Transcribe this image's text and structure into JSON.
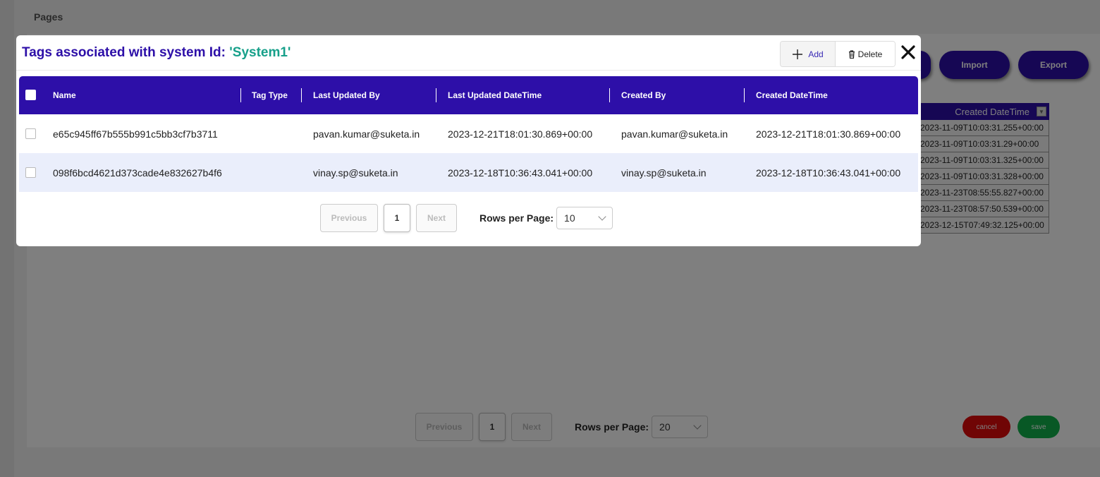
{
  "background": {
    "pages_title": "Pages",
    "buttons": {
      "import": "Import",
      "export": "Export"
    },
    "grid": {
      "header": "Created DateTime",
      "rows": [
        "2023-11-09T10:03:31.255+00:00",
        "2023-11-09T10:03:31.29+00:00",
        "2023-11-09T10:03:31.325+00:00",
        "2023-11-09T10:03:31.328+00:00",
        "2023-11-23T08:55:55.827+00:00",
        "2023-11-23T08:57:50.539+00:00",
        "2023-12-15T07:49:32.125+00:00"
      ]
    },
    "pagination": {
      "previous": "Previous",
      "current_page": "1",
      "next": "Next",
      "rows_per_page_label": "Rows per Page:",
      "rows_per_page_value": "20"
    },
    "cancel": "cancel",
    "save": "save"
  },
  "modal": {
    "title_prefix": "Tags associated with system Id: ",
    "system_id": "'System1'",
    "toolbar": {
      "add": "Add",
      "delete": "Delete"
    },
    "table": {
      "columns": [
        "Name",
        "Tag Type",
        "Last Updated By",
        "Last Updated DateTime",
        "Created By",
        "Created DateTime"
      ],
      "rows": [
        {
          "name": "e65c945ff67b555b991c5bb3cf7b3711",
          "tag_type": "",
          "last_updated_by": "pavan.kumar@suketa.in",
          "last_updated_datetime": "2023-12-21T18:01:30.869+00:00",
          "created_by": "pavan.kumar@suketa.in",
          "created_datetime": "2023-12-21T18:01:30.869+00:00"
        },
        {
          "name": "098f6bcd4621d373cade4e832627b4f6",
          "tag_type": "",
          "last_updated_by": "vinay.sp@suketa.in",
          "last_updated_datetime": "2023-12-18T10:36:43.041+00:00",
          "created_by": "vinay.sp@suketa.in",
          "created_datetime": "2023-12-18T10:36:43.041+00:00"
        }
      ]
    },
    "pagination": {
      "previous": "Previous",
      "current_page": "1",
      "next": "Next",
      "rows_per_page_label": "Rows per Page:",
      "rows_per_page_value": "10"
    }
  },
  "colors": {
    "primary": "#2d0fa8",
    "accent": "#17a08a",
    "cancel": "#e00b0b",
    "save": "#10b04a",
    "row_alt": "#eaeefb"
  }
}
